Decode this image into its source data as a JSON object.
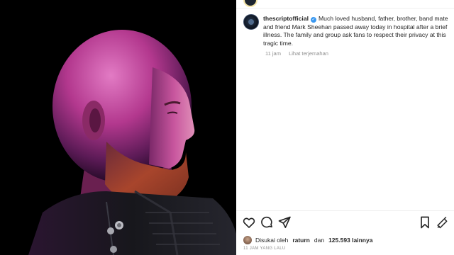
{
  "post": {
    "username": "thescriptofficial",
    "verified_icon": "verified-badge-icon",
    "caption": "Much loved husband, father, brother, band mate and friend Mark Sheehan passed away today in hospital after a brief illness. The family and group ask fans to respect their privacy at this tragic time.",
    "time_short": "11 jam",
    "translate_label": "Lihat terjemahan",
    "likes_prefix": "Disukai oleh",
    "likes_user": "raturn",
    "likes_conj": "dan",
    "likes_count": "125.593 lainnya",
    "time_long": "11 JAM YANG LALU"
  },
  "actions": {
    "like_icon": "heart-icon",
    "comment_icon": "comment-icon",
    "share_icon": "send-icon",
    "save_icon": "bookmark-icon",
    "more_icon": "three-dots-icon"
  },
  "colors": {
    "photo_background": "#000000",
    "magenta_light": "#c0389a",
    "beard": "#9a4a2e",
    "jacket": "#1a1a1e",
    "verified": "#3897f0",
    "text": "#262626",
    "muted": "#8e8e8e"
  }
}
